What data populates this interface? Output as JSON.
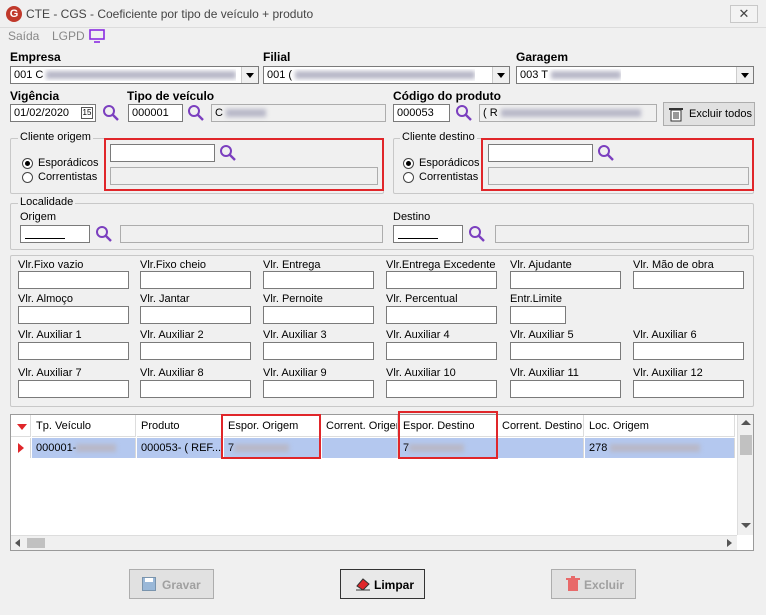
{
  "window": {
    "title": "CTE - CGS - Coeficiente por tipo de veículo + produto",
    "close": "✕"
  },
  "menu": {
    "saida": "Saída",
    "lgpd": "LGPD"
  },
  "empresa": {
    "label": "Empresa",
    "value": "001 C"
  },
  "filial": {
    "label": "Filial",
    "value": "001 ("
  },
  "garagem": {
    "label": "Garagem",
    "value": "003 T"
  },
  "vigencia": {
    "label": "Vigência",
    "value": "01/02/2020",
    "calendar": "15"
  },
  "tipo_veiculo": {
    "label": "Tipo de veículo",
    "value": "000001",
    "desc": "C"
  },
  "codigo_produto": {
    "label": "Código do produto",
    "value": "000053",
    "desc": "( R"
  },
  "excluir_todos": {
    "label": "Excluir todos"
  },
  "cliente_origem": {
    "title": "Cliente origem",
    "opt1": "Esporádicos",
    "opt2": "Correntistas"
  },
  "cliente_destino": {
    "title": "Cliente destino",
    "opt1": "Esporádicos",
    "opt2": "Correntistas"
  },
  "localidade": {
    "title": "Localidade",
    "origem": "Origem",
    "destino": "Destino"
  },
  "valores": {
    "r1": [
      "Vlr.Fixo vazio",
      "Vlr.Fixo cheio",
      "Vlr. Entrega",
      "Vlr.Entrega Excedente",
      "Vlr. Ajudante",
      "Vlr. Mão de obra"
    ],
    "r2": [
      "Vlr. Almoço",
      "Vlr. Jantar",
      "Vlr. Pernoite",
      "Vlr. Percentual",
      "Entr.Limite"
    ],
    "r3": [
      "Vlr. Auxiliar 1",
      "Vlr. Auxiliar 2",
      "Vlr. Auxiliar 3",
      "Vlr. Auxiliar 4",
      "Vlr. Auxiliar 5",
      "Vlr. Auxiliar 6"
    ],
    "r4": [
      "Vlr. Auxiliar 7",
      "Vlr. Auxiliar 8",
      "Vlr. Auxiliar 9",
      "Vlr. Auxiliar 10",
      "Vlr. Auxiliar 11",
      "Vlr. Auxiliar 12"
    ]
  },
  "grid": {
    "headers": [
      "Tp. Veículo",
      "Produto",
      "Espor. Origem",
      "Corrent. Origem",
      "Espor. Destino",
      "Corrent. Destino",
      "Loc. Origem"
    ],
    "row": [
      "000001-",
      "000053- ( REF...",
      "7",
      "",
      "7",
      "",
      "278"
    ]
  },
  "buttons": {
    "gravar": "Gravar",
    "limpar": "Limpar",
    "excluir": "Excluir"
  },
  "colors": {
    "highlight": "#e0262a",
    "selection": "#b4c8ef",
    "search_icon": "#7b3fbf"
  }
}
